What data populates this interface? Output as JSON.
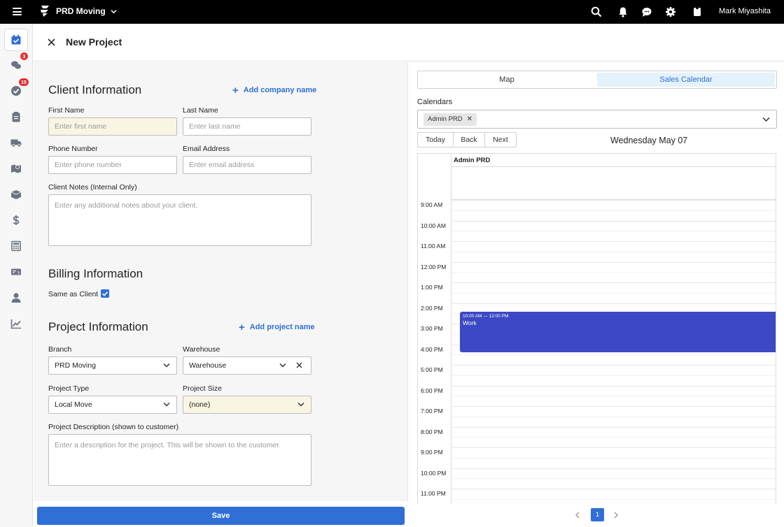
{
  "topbar": {
    "brand": "PRD Moving",
    "user_name": "Mark Miyashita",
    "icons": [
      "menu-icon",
      "logo-icon",
      "search-icon",
      "bell-icon",
      "chat-icon",
      "gear-icon",
      "ticket-icon"
    ]
  },
  "leftrail": {
    "items": [
      {
        "icon": "calendar-check-icon",
        "active": true
      },
      {
        "icon": "chat-bubbles-icon",
        "badge": "3"
      },
      {
        "icon": "check-circle-icon",
        "badge": "15"
      },
      {
        "icon": "clipboard-icon"
      },
      {
        "icon": "truck-icon"
      },
      {
        "icon": "map-icon"
      },
      {
        "icon": "box-icon"
      },
      {
        "icon": "dollar-icon"
      },
      {
        "icon": "calculator-icon"
      },
      {
        "icon": "payment-card-icon"
      },
      {
        "icon": "user-icon"
      },
      {
        "icon": "chart-line-icon"
      }
    ]
  },
  "header": {
    "title": "New Project"
  },
  "client": {
    "title": "Client Information",
    "add_company": "Add company name",
    "first_name_label": "First Name",
    "first_name_placeholder": "Enter first name",
    "last_name_label": "Last Name",
    "last_name_placeholder": "Enter last name",
    "phone_label": "Phone Number",
    "phone_placeholder": "Enter phone number",
    "email_label": "Email Address",
    "email_placeholder": "Enter email address",
    "notes_label": "Client Notes (Internal Only)",
    "notes_placeholder": "Enter any additional notes about your client."
  },
  "billing": {
    "title": "Billing Information",
    "same_as_client": "Same as Client",
    "same_as_client_checked": true
  },
  "project": {
    "title": "Project Information",
    "add_project": "Add project name",
    "branch_label": "Branch",
    "branch_value": "PRD Moving",
    "warehouse_label": "Warehouse",
    "warehouse_value": "Warehouse",
    "type_label": "Project Type",
    "type_value": "Local Move",
    "size_label": "Project Size",
    "size_value": "(none)",
    "description_label": "Project Description (shown to customer)",
    "description_placeholder": "Enter a description for the project. This will be shown to the customer."
  },
  "save_label": "Save",
  "calendar": {
    "tabs": [
      "Map",
      "Sales Calendar"
    ],
    "active_tab": "Sales Calendar",
    "calendars_label": "Calendars",
    "selected_calendar": "Admin PRD",
    "nav": {
      "today": "Today",
      "back": "Back",
      "next": "Next"
    },
    "date_title": "Wednesday May 07",
    "column_header": "Admin PRD",
    "times": [
      "9:00 AM",
      "10:00 AM",
      "11:00 AM",
      "12:00 PM",
      "1:00 PM",
      "2:00 PM",
      "3:00 PM",
      "4:00 PM",
      "5:00 PM",
      "6:00 PM",
      "7:00 PM",
      "8:00 PM",
      "9:00 PM",
      "10:00 PM",
      "11:00 PM"
    ],
    "event": {
      "time": "10:00 AM — 12:00 PM",
      "title": "Work",
      "color": "#3b49c4"
    },
    "page": "1"
  },
  "colors": {
    "accent": "#2f6fd6",
    "topbar": "#000000",
    "badge": "#e03131"
  }
}
